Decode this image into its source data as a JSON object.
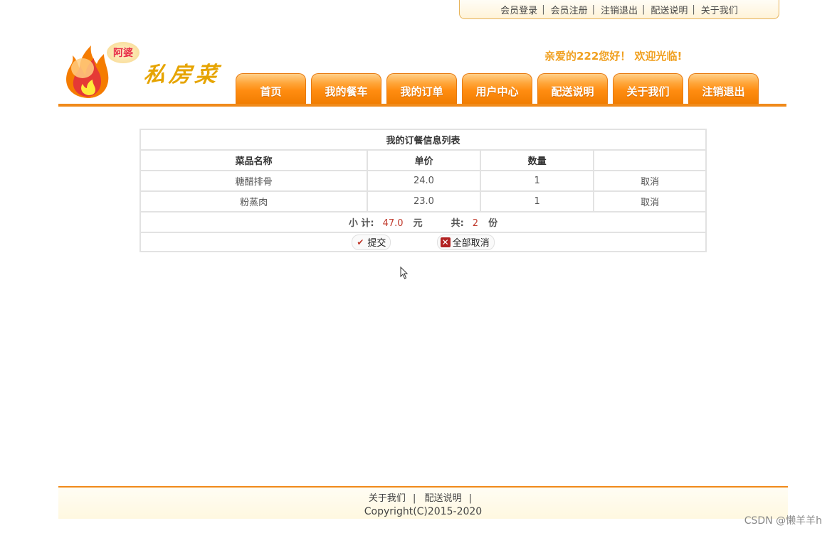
{
  "top_links": {
    "items": [
      "会员登录",
      "会员注册",
      "注销退出",
      "配送说明",
      "关于我们"
    ],
    "separator": "|"
  },
  "logo": {
    "badge": "阿婆",
    "text": "私房菜"
  },
  "welcome": "亲爱的222您好！ 欢迎光临!",
  "nav": {
    "tabs": [
      "首页",
      "我的餐车",
      "我的订单",
      "用户中心",
      "配送说明",
      "关于我们",
      "注销退出"
    ]
  },
  "order": {
    "title": "我的订餐信息列表",
    "headers": [
      "菜品名称",
      "单价",
      "数量",
      ""
    ],
    "rows": [
      {
        "name": "糖醋排骨",
        "price": "24.0",
        "qty": "1",
        "action": "取消"
      },
      {
        "name": "粉蒸肉",
        "price": "23.0",
        "qty": "1",
        "action": "取消"
      }
    ],
    "summary": {
      "subtotal_label": "小 计:",
      "subtotal_value": "47.0",
      "currency": "元",
      "total_label": "共:",
      "total_count": "2",
      "unit": "份"
    },
    "buttons": {
      "submit": "提交",
      "cancel_all": "全部取消"
    }
  },
  "footer": {
    "links": [
      "关于我们",
      "配送说明"
    ],
    "separator": "|",
    "copyright": "Copyright(C)2015-2020"
  },
  "watermark": "CSDN @懒羊羊h",
  "colors": {
    "accent": "#f08a1a",
    "welcome": "#f0a020",
    "price_highlight": "#c0392b"
  }
}
